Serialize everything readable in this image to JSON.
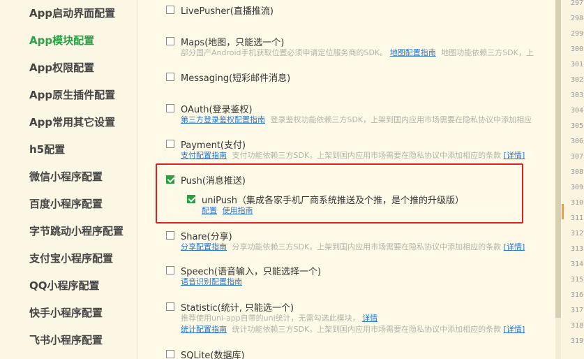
{
  "sidebar": {
    "items": [
      {
        "label": "App启动界面配置",
        "active": false
      },
      {
        "label": "App模块配置",
        "active": true
      },
      {
        "label": "App权限配置",
        "active": false
      },
      {
        "label": "App原生插件配置",
        "active": false
      },
      {
        "label": "App常用其它设置",
        "active": false
      },
      {
        "label": "h5配置",
        "active": false
      },
      {
        "label": "微信小程序配置",
        "active": false
      },
      {
        "label": "百度小程序配置",
        "active": false
      },
      {
        "label": "字节跳动小程序配置",
        "active": false
      },
      {
        "label": "支付宝小程序配置",
        "active": false
      },
      {
        "label": "QQ小程序配置",
        "active": false
      },
      {
        "label": "快手小程序配置",
        "active": false
      },
      {
        "label": "飞书小程序配置",
        "active": false
      }
    ]
  },
  "modules": {
    "livepusher": {
      "label": "LivePusher(直播推流)",
      "checked": false
    },
    "maps": {
      "label": "Maps(地图，只能选一个)",
      "checked": false,
      "desc1": "部分国产Android手机获取位置必须申请定位服务商的SDK。",
      "link": "地图配置指南",
      "desc2": "地图功能依赖三方SDK，上"
    },
    "messaging": {
      "label": "Messaging(短彩邮件消息)",
      "checked": false
    },
    "oauth": {
      "label": "OAuth(登录鉴权)",
      "checked": false,
      "link": "第三方登录鉴权配置指南",
      "desc": "登录鉴权功能依赖三方SDK，上架到国内应用市场需要在隐私协议中添加相应"
    },
    "payment": {
      "label": "Payment(支付)",
      "checked": false,
      "link": "支付配置指南",
      "desc": "支付功能依赖三方SDK，上架到国内应用市场需要在隐私协议中添加相应的条款",
      "detail": "[详情]"
    },
    "push": {
      "label": "Push(消息推送)",
      "checked": true,
      "unipush": {
        "label": "uniPush（集成各家手机厂商系统推送及个推，是个推的升级版）",
        "checked": true,
        "link_config": "配置",
        "link_guide": "使用指南"
      }
    },
    "share": {
      "label": "Share(分享)",
      "checked": false,
      "link": "分享配置指南",
      "desc": "分享功能依赖三方SDK，上架到国内应用市场需要在隐私协议中添加相应的条款",
      "detail": "[详情]"
    },
    "speech": {
      "label": "Speech(语音输入，只能选择一个)",
      "checked": false,
      "link": "语音识别配置指南"
    },
    "statistic": {
      "label": "Statistic(统计, 只能选一个)",
      "checked": false,
      "desc1": "推荐使用uni-app自带的uni统计，无需勾选此模块，",
      "link1": "详情",
      "link2": "统计配置指南",
      "desc2": "统计功能依赖三方SDK，上架到国内应用市场需要在隐私协议中添加相应的条款",
      "detail": "[详情]"
    },
    "sqlite": {
      "label": "SQLite(数据库)",
      "checked": false
    }
  },
  "gutter": {
    "lines": [
      "297",
      "298",
      "299",
      "300",
      "301",
      "302",
      "303",
      "304",
      "305",
      "306",
      "307",
      "308",
      "309",
      "310",
      "311",
      "312",
      "313",
      "314",
      "315",
      "316",
      "317",
      "318",
      "319"
    ]
  },
  "colors": {
    "accent_green": "#27a03f",
    "link_blue": "#2477d6",
    "highlight_red": "#e02020"
  }
}
